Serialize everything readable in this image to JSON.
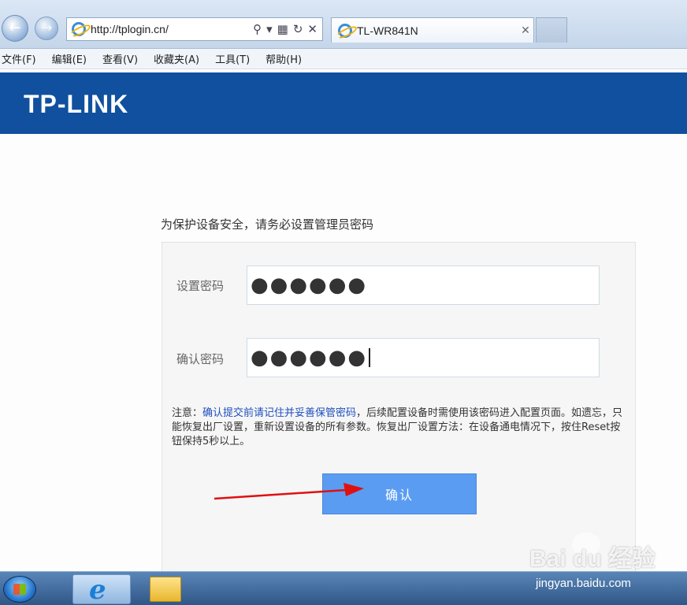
{
  "browser": {
    "address": "http://tplogin.cn/",
    "tab_title": "TL-WR841N"
  },
  "menu": [
    "文件(F)",
    "编辑(E)",
    "查看(V)",
    "收藏夹(A)",
    "工具(T)",
    "帮助(H)"
  ],
  "header": {
    "logo": "TP-LINK"
  },
  "page": {
    "intro": "为保护设备安全，请务必设置管理员密码",
    "set_password_label": "设置密码",
    "set_password_value": "●●●●●●",
    "confirm_password_label": "确认密码",
    "confirm_password_value": "●●●●●●",
    "notice_prefix": "注意：",
    "notice_highlight": "确认提交前请记住并妥善保管密码",
    "notice_rest": "，后续配置设备时需使用该密码进入配置页面。如遗忘，只能恢复出厂设置，重新设置设备的所有参数。恢复出厂设置方法：在设备通电情况下，按住Reset按钮保持5秒以上。",
    "confirm_button": "确认"
  },
  "watermark": {
    "brand": "Bai du 经验",
    "url": "jingyan.baidu.com"
  },
  "colors": {
    "brand_blue": "#10509e",
    "button_blue": "#5b9cf3",
    "arrow_red": "#e01010"
  }
}
